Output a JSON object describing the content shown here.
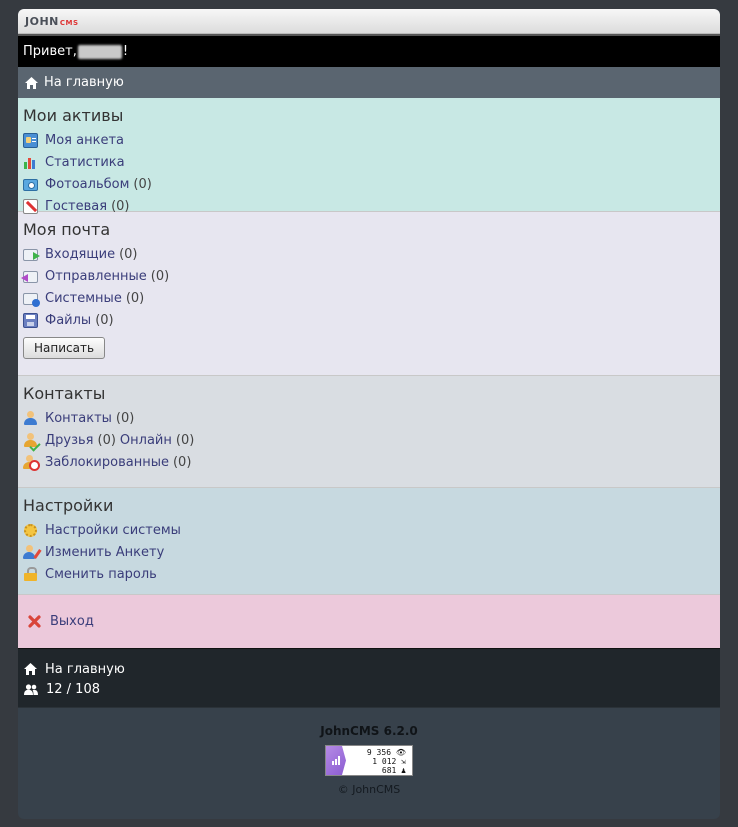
{
  "logo": {
    "main": "JOHN",
    "sub": "CMS"
  },
  "greeting": {
    "prefix": "Привет, ",
    "suffix": "!"
  },
  "nav": {
    "home": "На главную"
  },
  "assets": {
    "title": "Мои активы",
    "items": [
      {
        "label": "Моя анкета",
        "count": ""
      },
      {
        "label": "Статистика",
        "count": ""
      },
      {
        "label": "Фотоальбом",
        "count": "(0)"
      },
      {
        "label": "Гостевая",
        "count": "(0)"
      }
    ]
  },
  "mail": {
    "title": "Моя почта",
    "items": [
      {
        "label": "Входящие",
        "count": "(0)"
      },
      {
        "label": "Отправленные",
        "count": "(0)"
      },
      {
        "label": "Системные",
        "count": "(0)"
      },
      {
        "label": "Файлы",
        "count": "(0)"
      }
    ],
    "write_button": "Написать"
  },
  "contacts": {
    "title": "Контакты",
    "items": [
      {
        "label": "Контакты",
        "count": "(0)"
      },
      {
        "label": "Друзья",
        "count": "(0)",
        "extra_label": "Онлайн",
        "extra_count": "(0)"
      },
      {
        "label": "Заблокированные",
        "count": "(0)"
      }
    ]
  },
  "settings": {
    "title": "Настройки",
    "items": [
      {
        "label": "Настройки системы"
      },
      {
        "label": "Изменить Анкету"
      },
      {
        "label": "Сменить пароль"
      }
    ]
  },
  "exit": {
    "label": "Выход"
  },
  "footer": {
    "home": "На главную",
    "online": "12 / 108",
    "version": "JohnCMS 6.2.0",
    "counter": {
      "views": "9 356",
      "hits": "1 012",
      "hosts": "681"
    },
    "copyright": "© JohnCMS"
  }
}
